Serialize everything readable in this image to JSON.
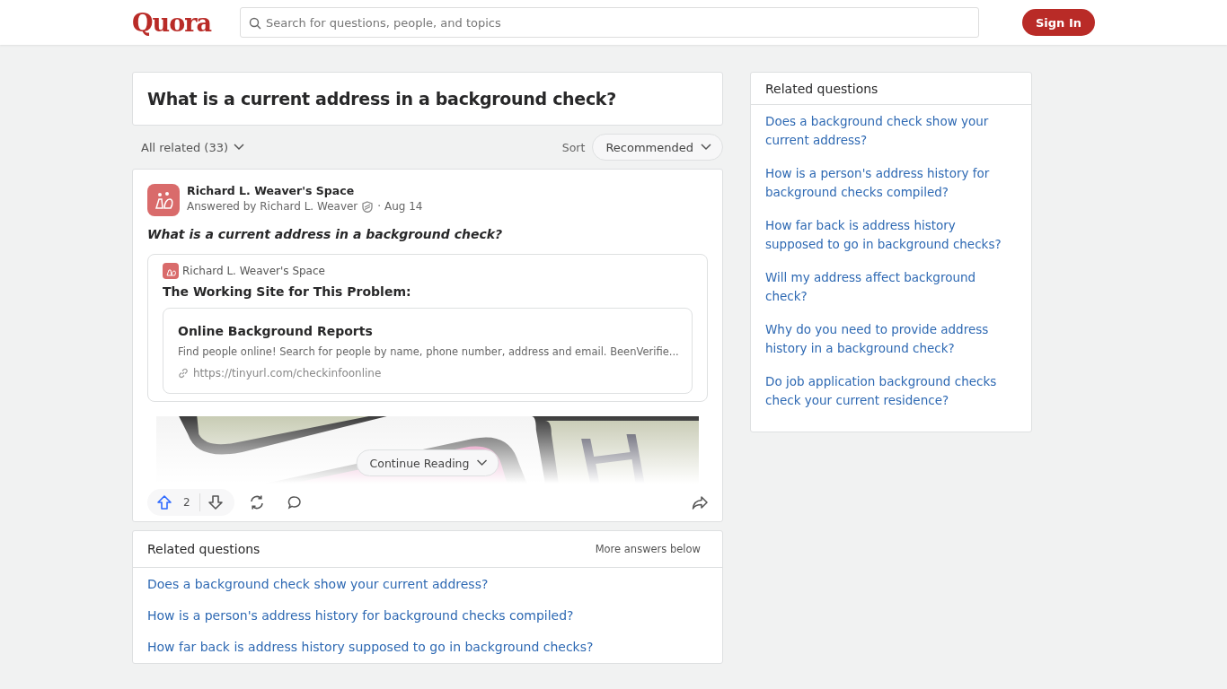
{
  "header": {
    "logo": "Quora",
    "search": {
      "placeholder": "Search for questions, people, and topics"
    },
    "sign_in": "Sign In"
  },
  "question": {
    "title": "What is a current address in a background check?"
  },
  "filter": {
    "all_related": "All related (33)",
    "sort_label": "Sort",
    "sort_value": "Recommended"
  },
  "answer": {
    "space": "Richard L. Weaver's Space",
    "byline": "Answered by Richard L. Weaver",
    "date": "· Aug 14",
    "question": "What is a current address in a background check?",
    "embed": {
      "space": "Richard L. Weaver's Space",
      "heading": "The Working Site for This Problem:",
      "link_title": "Online Background Reports",
      "link_desc": "Find people online! Search for people by name, phone number, address and email. BeenVerifie...",
      "link_url": "https://tinyurl.com/checkinfoonline"
    },
    "continue": "Continue Reading",
    "upvotes": "2"
  },
  "related_bottom": {
    "title": "Related questions",
    "more": "More answers below",
    "items": [
      "Does a background check show your current address?",
      "How is a person's address history for background checks compiled?",
      "How far back is address history supposed to go in background checks?"
    ]
  },
  "related_side": {
    "title": "Related questions",
    "items": [
      "Does a background check show your current address?",
      "How is a person's address history for background checks compiled?",
      "How far back is address history supposed to go in background checks?",
      "Will my address affect background check?",
      "Why do you need to provide address history in a background check?",
      "Do job application background checks check your current residence?"
    ]
  }
}
